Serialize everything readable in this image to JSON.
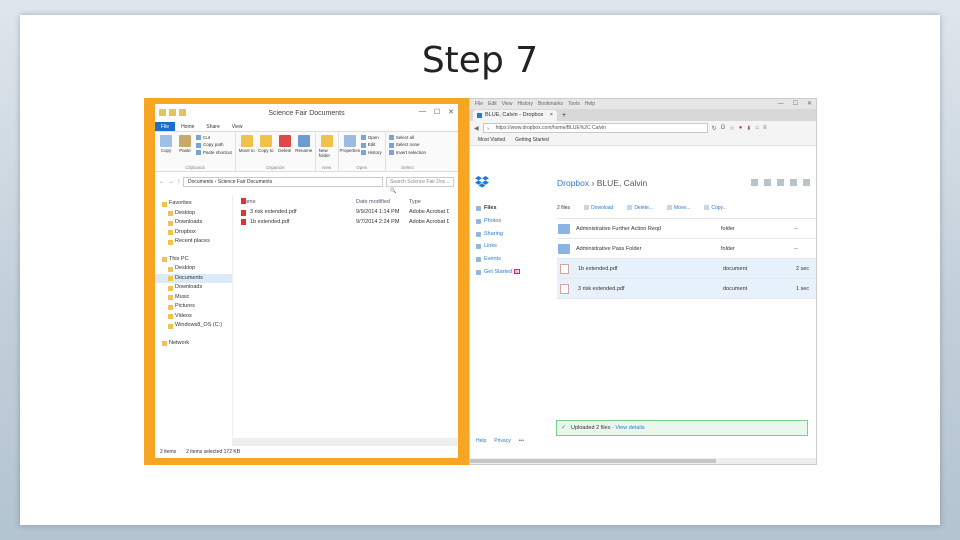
{
  "slide": {
    "title": "Step 7"
  },
  "explorer": {
    "window_title": "Science Fair Documents",
    "window_buttons": [
      "—",
      "☐",
      "✕"
    ],
    "tabs": [
      "File",
      "Home",
      "Share",
      "View"
    ],
    "ribbon": {
      "clipboard": {
        "copy": "Copy",
        "paste": "Paste",
        "cut": "Cut",
        "copy_path": "Copy path",
        "paste_shortcut": "Paste shortcut",
        "group": "Clipboard"
      },
      "organize": {
        "move_to": "Move to",
        "copy_to": "Copy to",
        "delete": "Delete",
        "rename": "Rename",
        "group": "Organize"
      },
      "new": {
        "new_folder": "New folder",
        "group": "New"
      },
      "open": {
        "properties": "Properties",
        "open": "Open",
        "edit": "Edit",
        "history": "History",
        "group": "Open"
      },
      "select": {
        "select_all": "Select all",
        "select_none": "Select none",
        "invert": "Invert selection",
        "group": "Select"
      }
    },
    "address": "Documents › Science Fair Documents",
    "search_placeholder": "Search Science Fair Doc... 🔍",
    "nav": {
      "favorites": "Favorites",
      "favorites_items": [
        "Desktop",
        "Downloads",
        "Dropbox",
        "Recent places"
      ],
      "this_pc": "This PC",
      "this_pc_items": [
        "Desktop",
        "Documents",
        "Downloads",
        "Music",
        "Pictures",
        "Videos",
        "Windows8_OS (C:)"
      ],
      "network": "Network"
    },
    "columns": {
      "name": "Name",
      "date": "Date modified",
      "type": "Type"
    },
    "files": [
      {
        "name": "3 risk extended.pdf",
        "date": "9/9/2014 1:14 PM",
        "type": "Adobe Acrobat D..."
      },
      {
        "name": "1b extended.pdf",
        "date": "9/7/2014 2:24 PM",
        "type": "Adobe Acrobat D..."
      }
    ],
    "status": {
      "items": "2 items",
      "selected": "2 items selected 172 KB"
    }
  },
  "browser": {
    "menu": [
      "File",
      "Edit",
      "View",
      "History",
      "Bookmarks",
      "Tools",
      "Help"
    ],
    "window_buttons": [
      "—",
      "☐",
      "✕"
    ],
    "tab_title": "BLUE, Calvin - Dropbox",
    "tab_close": "×",
    "new_tab": "+",
    "url": "https://www.dropbox.com/home/BLUE%2C Calvin",
    "bookmarks": [
      "Most Visited",
      "Getting Started"
    ],
    "sidebar": {
      "items": [
        "Files",
        "Photos",
        "Sharing",
        "Links",
        "Events",
        "Get Started"
      ],
      "badge": "5",
      "footer": [
        "Help",
        "Privacy",
        "•••"
      ]
    },
    "breadcrumb": {
      "root": "Dropbox",
      "separator": "›",
      "current": "BLUE, Calvin"
    },
    "actions": {
      "count": "2 files",
      "download": "Download",
      "delete": "Delete...",
      "move": "Move...",
      "copy": "Copy..."
    },
    "rows": [
      {
        "name": "Administrative Further Action Reqd",
        "kind": "folder",
        "modified": "--",
        "icon": "folder-icon",
        "selected": false
      },
      {
        "name": "Administrative Pass Folder",
        "kind": "folder",
        "modified": "--",
        "icon": "folder-icon",
        "selected": false
      },
      {
        "name": "1b extended.pdf",
        "kind": "document",
        "modified": "2 sec",
        "icon": "pdf-icon",
        "selected": true
      },
      {
        "name": "3 risk extended.pdf",
        "kind": "document",
        "modified": "1 sec",
        "icon": "pdf-icon",
        "selected": true
      }
    ],
    "upload": {
      "message": "Uploaded 2 files · ",
      "link": "View details"
    }
  }
}
